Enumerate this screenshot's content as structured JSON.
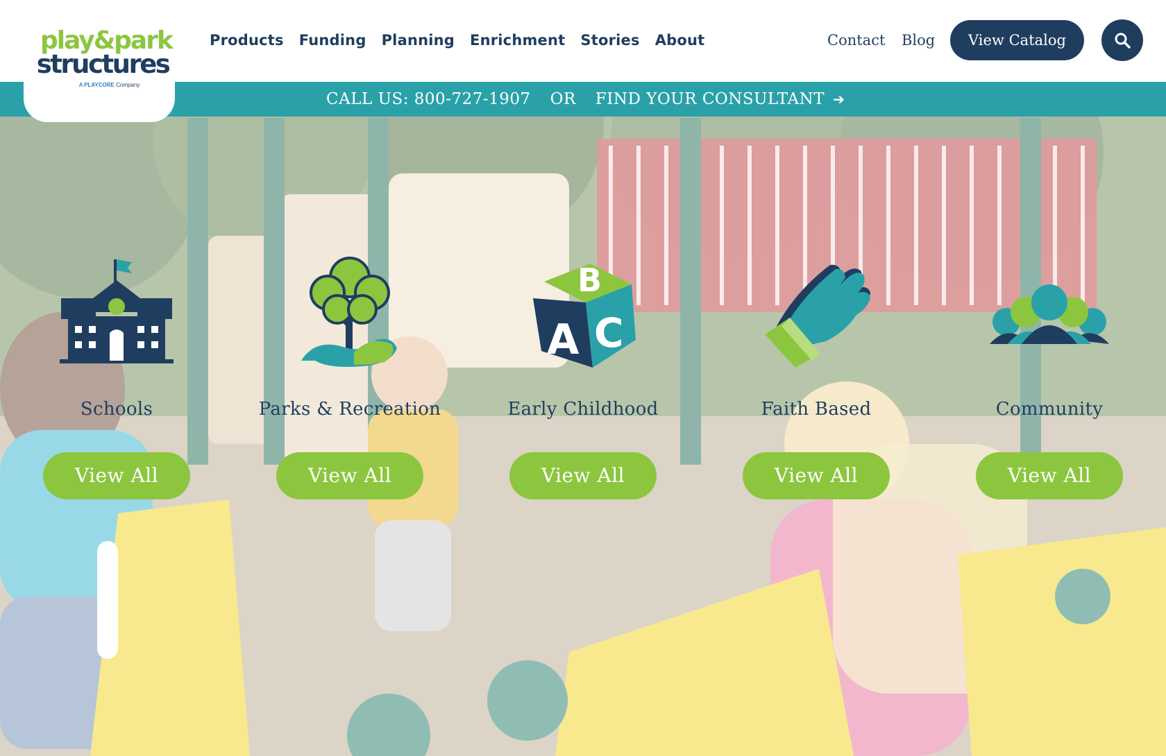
{
  "logo": {
    "line1": "play&park",
    "line2": "structures",
    "sub_prefix": "A",
    "sub_brand": "PLAYCORE",
    "sub_suffix": "Company"
  },
  "nav": {
    "items": [
      "Products",
      "Funding",
      "Planning",
      "Enrichment",
      "Stories",
      "About"
    ]
  },
  "utility": {
    "contact": "Contact",
    "blog": "Blog",
    "catalog": "View Catalog"
  },
  "callbar": {
    "phone": "CALL US: 800-727-1907",
    "or": "OR",
    "consultant": "FIND YOUR CONSULTANT",
    "arrow": "➔"
  },
  "categories": [
    {
      "label": "Schools",
      "button": "View All",
      "icon": "school-icon"
    },
    {
      "label": "Parks & Recreation",
      "button": "View All",
      "icon": "tree-icon"
    },
    {
      "label": "Early Childhood",
      "button": "View All",
      "icon": "abc-blocks-icon"
    },
    {
      "label": "Faith Based",
      "button": "View All",
      "icon": "praying-hand-icon"
    },
    {
      "label": "Community",
      "button": "View All",
      "icon": "people-group-icon"
    }
  ],
  "colors": {
    "navy": "#1f3e5f",
    "teal": "#2aa1a9",
    "green": "#8cc63f",
    "red_accent": "#c8303a"
  }
}
